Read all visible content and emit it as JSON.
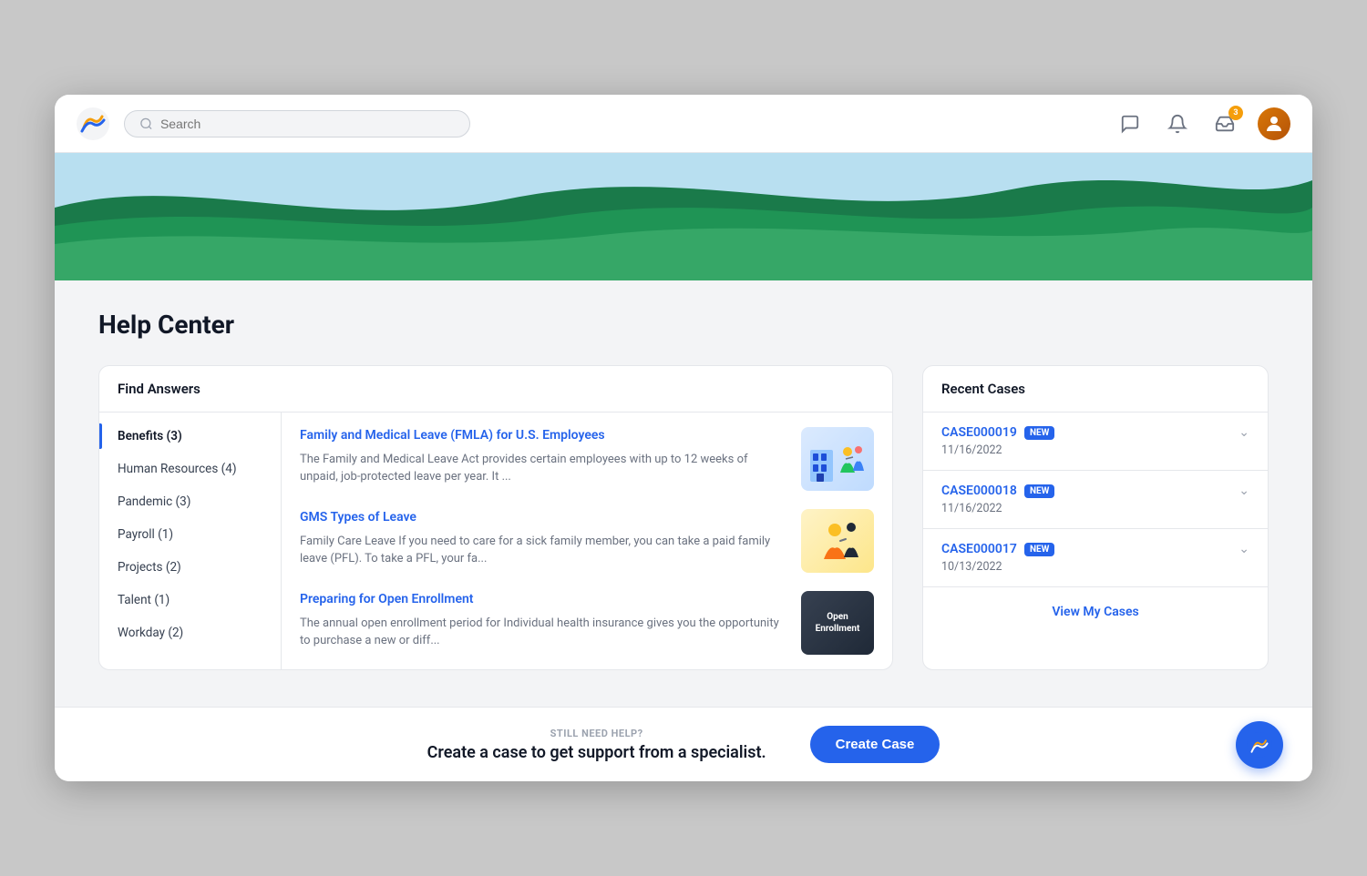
{
  "nav": {
    "search_placeholder": "Search",
    "notification_badge": "3"
  },
  "page": {
    "title": "Help Center"
  },
  "find_answers": {
    "section_title": "Find Answers",
    "categories": [
      {
        "label": "Benefits (3)",
        "active": true
      },
      {
        "label": "Human Resources (4)",
        "active": false
      },
      {
        "label": "Pandemic (3)",
        "active": false
      },
      {
        "label": "Payroll (1)",
        "active": false
      },
      {
        "label": "Projects (2)",
        "active": false
      },
      {
        "label": "Talent (1)",
        "active": false
      },
      {
        "label": "Workday (2)",
        "active": false
      }
    ],
    "articles": [
      {
        "title": "Family and Medical Leave (FMLA) for U.S. Employees",
        "description": "The Family and Medical Leave Act provides certain employees with up to 12 weeks of unpaid, job-protected leave per year. It ...",
        "thumb_type": "fmla"
      },
      {
        "title": "GMS Types of Leave",
        "description": "Family Care Leave If you need to care for a sick family member, you can take a paid family leave (PFL). To take a PFL, your fa...",
        "thumb_type": "gms"
      },
      {
        "title": "Preparing for Open Enrollment",
        "description": "The annual open enrollment period for Individual health insurance gives you the opportunity to purchase a new or diff...",
        "thumb_type": "enrollment"
      }
    ]
  },
  "recent_cases": {
    "section_title": "Recent Cases",
    "cases": [
      {
        "id": "CASE000019",
        "badge": "NEW",
        "date": "11/16/2022"
      },
      {
        "id": "CASE000018",
        "badge": "NEW",
        "date": "11/16/2022"
      },
      {
        "id": "CASE000017",
        "badge": "NEW",
        "date": "10/13/2022"
      }
    ],
    "view_all_label": "View My Cases"
  },
  "footer": {
    "still_need_help": "STILL NEED HELP?",
    "cta_text": "Create a case to get support from a specialist.",
    "create_case_label": "Create Case"
  }
}
